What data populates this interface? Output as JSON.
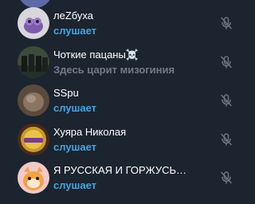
{
  "colors": {
    "background": "#1c242f",
    "name_text": "#ffffff",
    "listening_text": "#4aa3df",
    "about_text": "#717b87",
    "mic_muted": "#6c7581"
  },
  "participants": [
    {
      "name": "леZбуха",
      "status": "слушает",
      "status_type": "listening",
      "mic": "muted-mic-icon"
    },
    {
      "name": "Чоткие пацаны☠️",
      "status": "Здесь царит мизогиния",
      "status_type": "about",
      "mic": "muted-mic-icon"
    },
    {
      "name": "SSpu",
      "status": "слушает",
      "status_type": "listening",
      "mic": "muted-mic-icon"
    },
    {
      "name": "Хуяра Николая",
      "status": "слушает",
      "status_type": "listening",
      "mic": "muted-mic-icon"
    },
    {
      "name": "Я РУССКАЯ И ГОРЖУСЬ🇱🇻...",
      "status": "слушает",
      "status_type": "listening",
      "mic": "muted-mic-icon"
    }
  ]
}
